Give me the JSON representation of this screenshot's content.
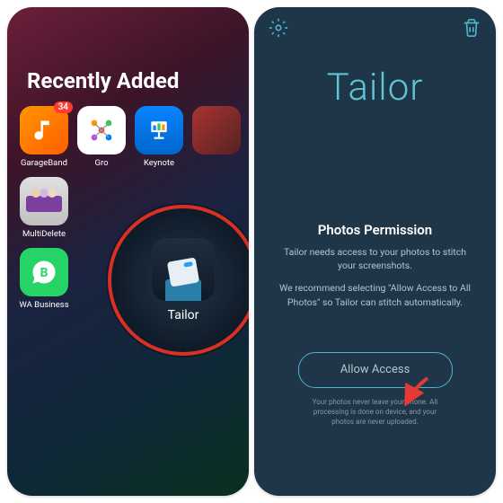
{
  "left": {
    "heading": "Recently Added",
    "apps": [
      {
        "label": "GarageBand",
        "klass": "garageband",
        "badge": "34"
      },
      {
        "label": "Gro",
        "klass": "graph"
      },
      {
        "label": "Keynote",
        "klass": "keynote"
      },
      {
        "label": "",
        "klass": ""
      },
      {
        "label": "MultiDelete",
        "klass": "multidel"
      },
      {
        "label": "",
        "klass": ""
      },
      {
        "label": "",
        "klass": ""
      },
      {
        "label": "",
        "klass": ""
      },
      {
        "label": "WA Business",
        "klass": "wab"
      }
    ],
    "highlight_label": "Tailor"
  },
  "right": {
    "brand": "Tailor",
    "title": "Photos Permission",
    "body1": "Tailor needs access to your photos to stitch your screenshots.",
    "body2": "We recommend selecting \"Allow Access to All Photos\" so Tailor can stitch automatically.",
    "button": "Allow Access",
    "footer": "Your photos never leave your phone. All processing is done on device, and your photos are never uploaded."
  }
}
